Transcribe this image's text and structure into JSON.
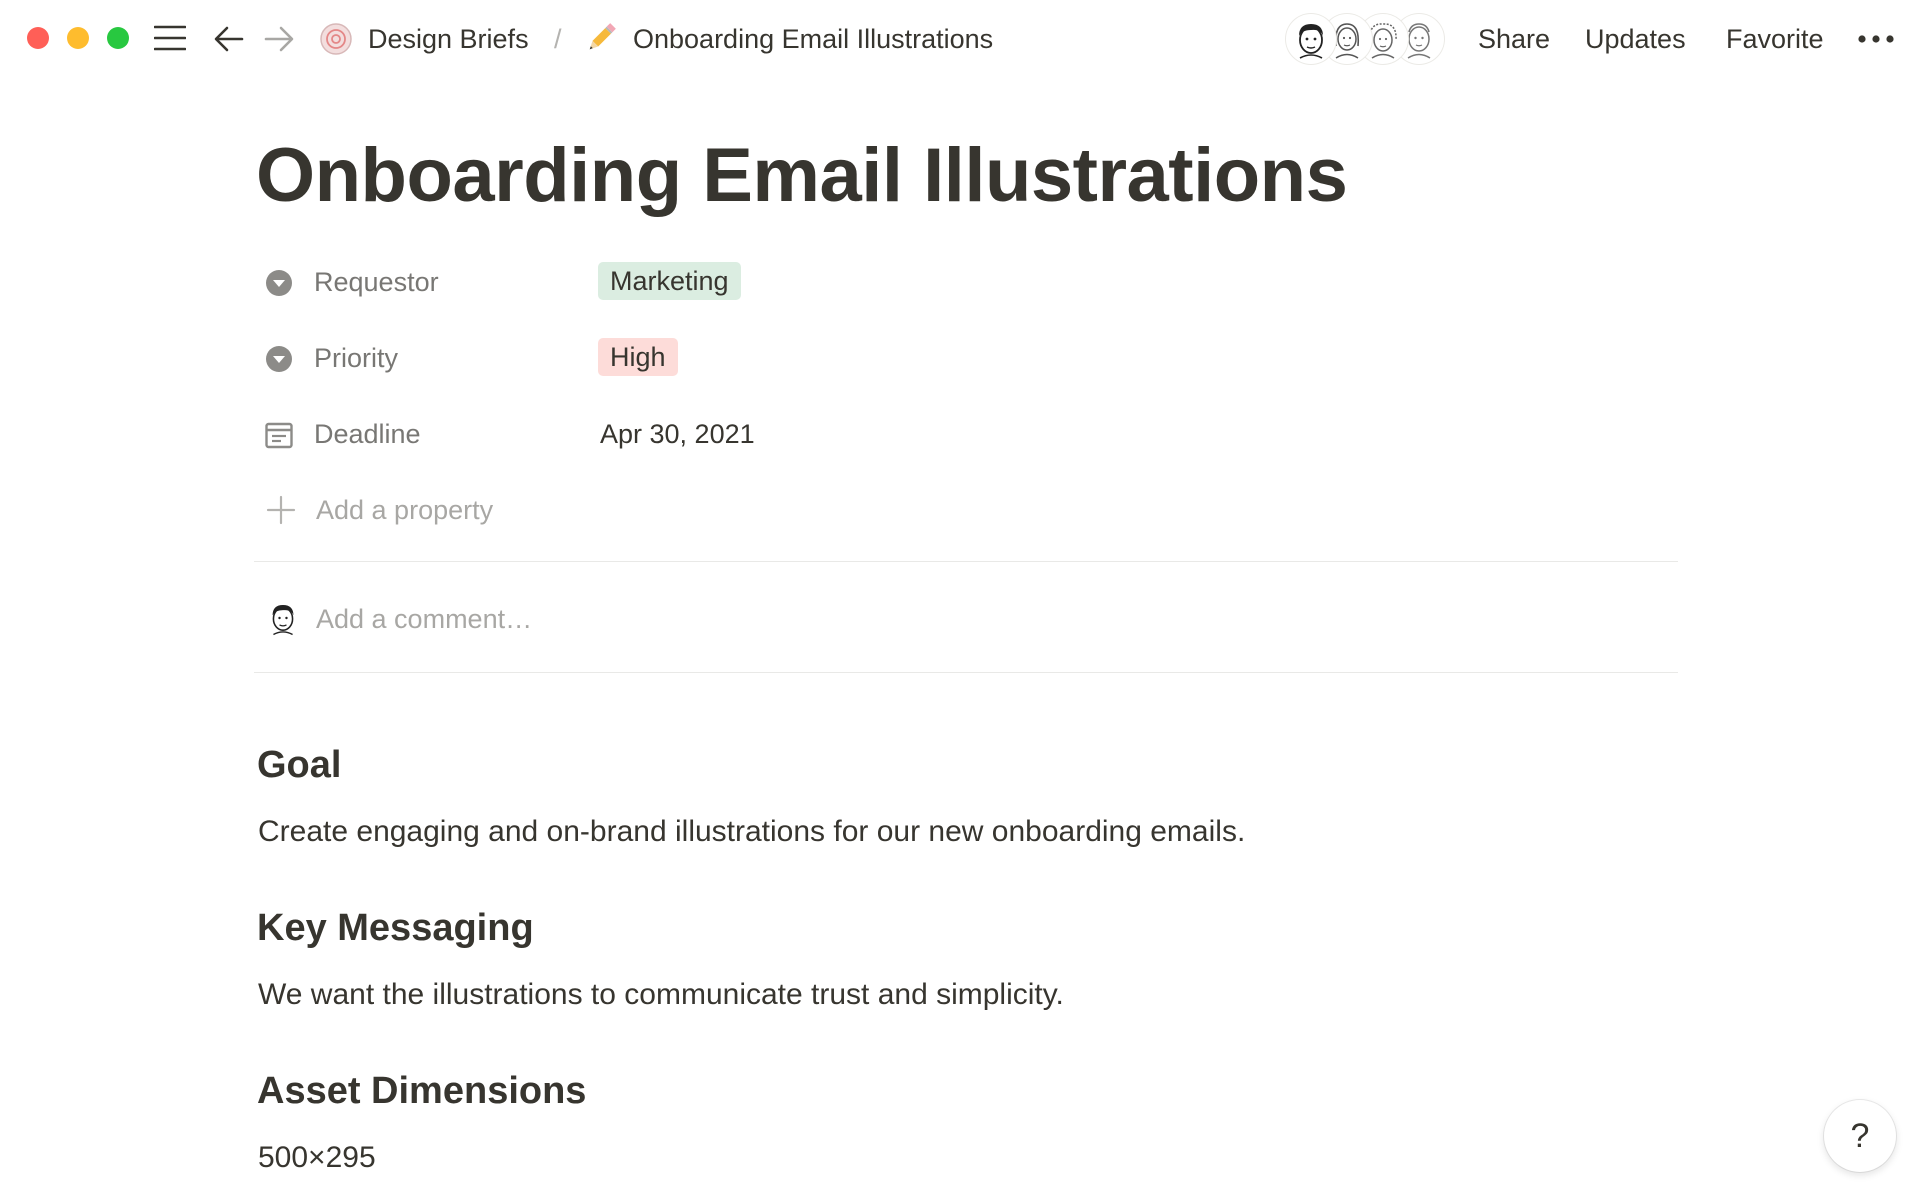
{
  "window": {
    "traffic_lights": {
      "close": "#ff5f57",
      "minimize": "#febc2e",
      "zoom": "#28c840"
    }
  },
  "topbar": {
    "nav_icons": [
      "menu-icon",
      "back-arrow-icon",
      "forward-arrow-icon"
    ],
    "breadcrumb": [
      {
        "label": "Design Briefs",
        "icon": "workspace-swirl-icon"
      },
      {
        "label": "Onboarding Email Illustrations",
        "icon": "pencil-icon"
      }
    ],
    "separator": "/",
    "avatars": [
      "avatar-user-1",
      "avatar-user-2",
      "avatar-user-3",
      "avatar-user-4"
    ],
    "share_label": "Share",
    "updates_label": "Updates",
    "favorite_label": "Favorite",
    "more_icon": "more-dots-icon"
  },
  "page": {
    "title": "Onboarding Email Illustrations",
    "properties": [
      {
        "label": "Requestor",
        "icon": "select-dropdown-icon",
        "value": "Marketing",
        "tag_color": "#dbede1"
      },
      {
        "label": "Priority",
        "icon": "select-dropdown-icon",
        "value": "High",
        "tag_color": "#fddcd9"
      },
      {
        "label": "Deadline",
        "icon": "calendar-icon",
        "value": "Apr 30, 2021"
      }
    ],
    "add_property_label": "Add a property",
    "comment": {
      "placeholder": "Add a comment…"
    },
    "sections": [
      {
        "heading": "Goal",
        "body": "Create engaging and on-brand illustrations for our new onboarding emails."
      },
      {
        "heading": "Key Messaging",
        "body": "We want the illustrations to communicate trust and simplicity."
      },
      {
        "heading": "Asset Dimensions",
        "body": "500×295"
      }
    ]
  },
  "help_button": {
    "label": "?"
  },
  "colors": {
    "text": "#37352f",
    "muted": "#787774",
    "divider": "#e9e9e7"
  }
}
